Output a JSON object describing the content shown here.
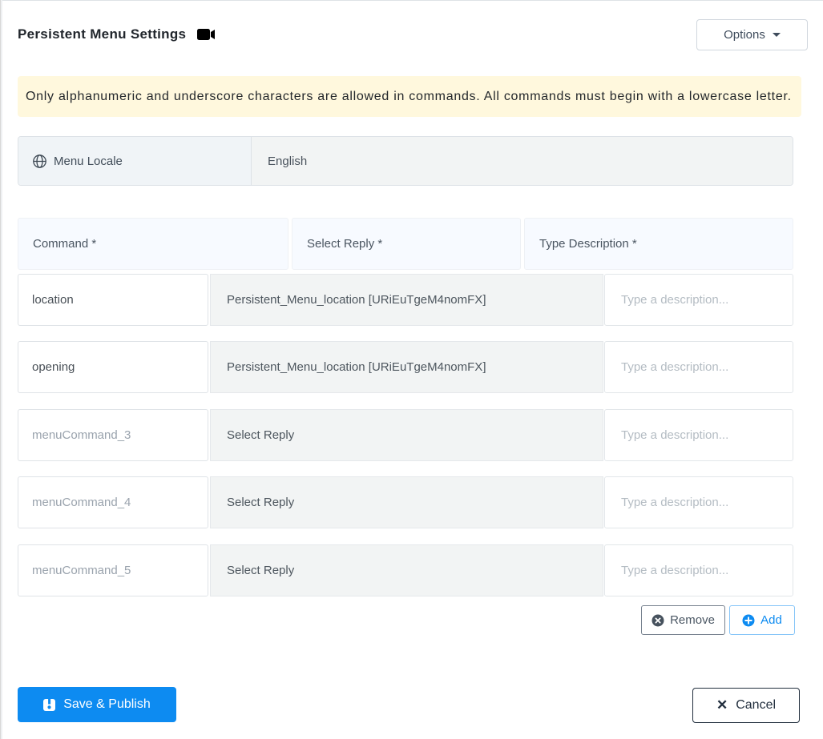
{
  "header": {
    "title": "Persistent Menu Settings",
    "options_label": "Options"
  },
  "alert": {
    "text": "Only alphanumeric and underscore characters are allowed in commands. All commands must begin with a lowercase letter."
  },
  "locale": {
    "label": "Menu Locale",
    "value": "English"
  },
  "table": {
    "columns": [
      {
        "label": "Command *"
      },
      {
        "label": "Select Reply *"
      },
      {
        "label": "Type Description *"
      }
    ],
    "description_placeholder": "Type a description...",
    "rows": [
      {
        "command": "location",
        "command_is_placeholder": false,
        "reply": "Persistent_Menu_location [URiEuTgeM4nomFX]",
        "reply_is_set": true
      },
      {
        "command": "opening",
        "command_is_placeholder": false,
        "reply": "Persistent_Menu_location [URiEuTgeM4nomFX]",
        "reply_is_set": true
      },
      {
        "command": "menuCommand_3",
        "command_is_placeholder": true,
        "reply": "Select Reply",
        "reply_is_set": false
      },
      {
        "command": "menuCommand_4",
        "command_is_placeholder": true,
        "reply": "Select Reply",
        "reply_is_set": false
      },
      {
        "command": "menuCommand_5",
        "command_is_placeholder": true,
        "reply": "Select Reply",
        "reply_is_set": false
      }
    ],
    "remove_label": "Remove",
    "add_label": "Add"
  },
  "footer": {
    "save_label": "Save & Publish",
    "cancel_label": "Cancel"
  },
  "colors": {
    "primary": "#0d8bf1",
    "alert_bg": "#fff8dd",
    "table_header_bg": "#f7faff",
    "select_bg": "#f2f4f4",
    "locale_label_bg": "#f0f4f7",
    "cancel_border": "#222f3e"
  }
}
